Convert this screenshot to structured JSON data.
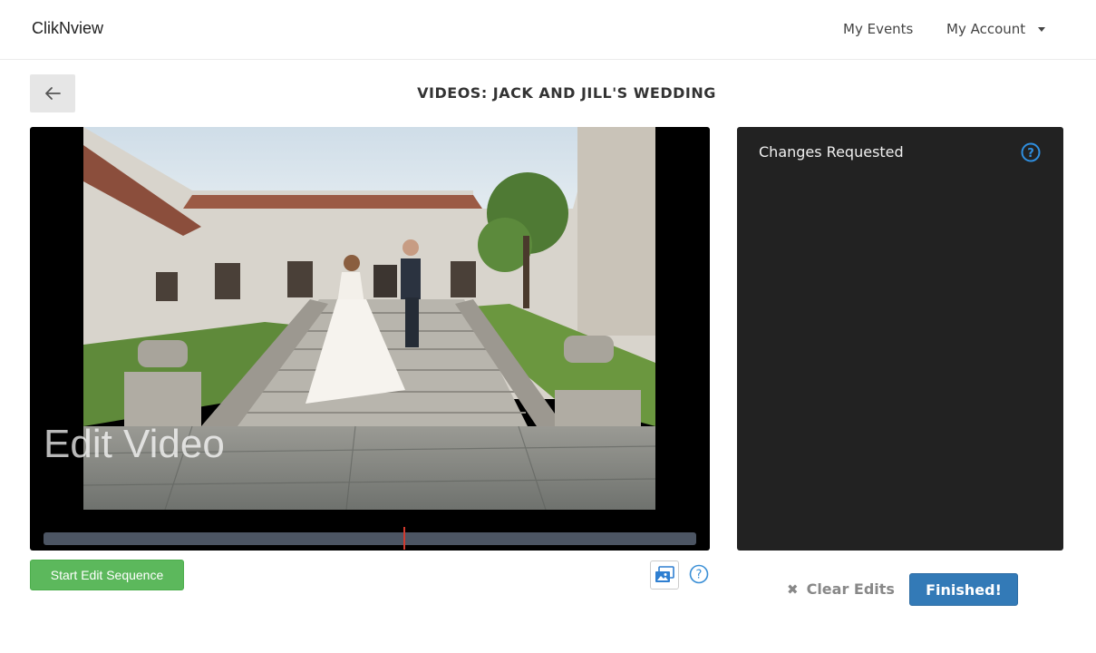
{
  "nav": {
    "brand": "ClikNview",
    "my_events": "My Events",
    "my_account": "My Account"
  },
  "page": {
    "title": "VIDEOS: JACK AND JILL'S WEDDING"
  },
  "player": {
    "overlay_label": "Edit Video",
    "progress_fraction": 0.552
  },
  "controls": {
    "start_edit_label": "Start Edit Sequence"
  },
  "changes": {
    "title": "Changes Requested"
  },
  "actions": {
    "clear_label": "Clear Edits",
    "finished_label": "Finished!"
  },
  "colors": {
    "accent_blue": "#337ab7",
    "success_green": "#5cb85c",
    "help_blue": "#2f8fe0",
    "panel_bg": "#222222",
    "playhead_red": "#d23a2e"
  },
  "icons": {
    "back": "arrow-left-icon",
    "account_dropdown": "caret-down-icon",
    "gallery": "images-icon",
    "help": "question-circle-icon",
    "clear": "times-icon"
  }
}
